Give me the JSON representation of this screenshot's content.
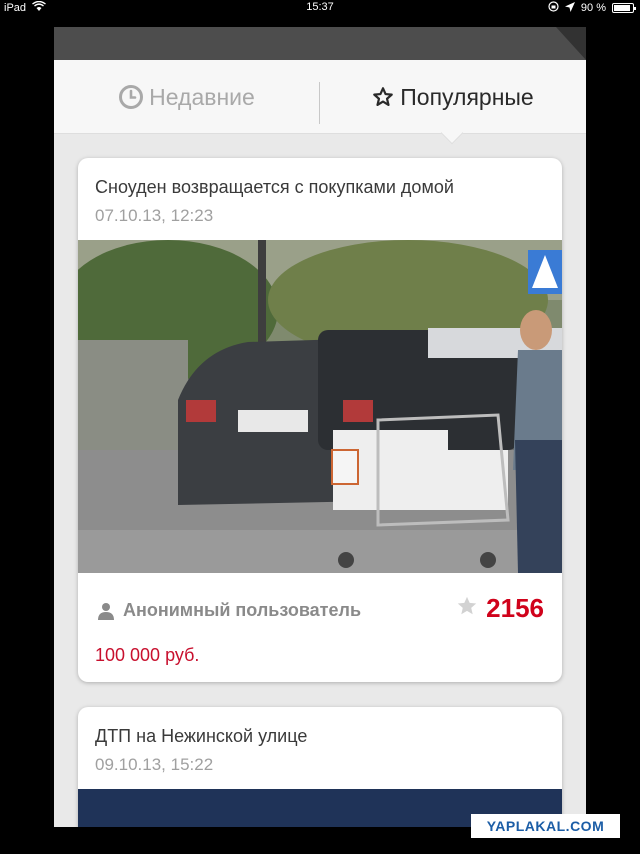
{
  "statusbar": {
    "device": "iPad",
    "time": "15:37",
    "battery_percent_label": "90 %",
    "battery_level": 0.9,
    "icons": [
      "wifi-icon",
      "rotation-lock-icon",
      "location-arrow-icon",
      "battery-icon"
    ]
  },
  "tabs": [
    {
      "label": "Недавние",
      "icon": "clock-icon",
      "active": false
    },
    {
      "label": "Популярные",
      "icon": "star-outline-icon",
      "active": true
    }
  ],
  "posts": [
    {
      "title": "Сноуден возвращается с покупками домой",
      "date": "07.10.13, 12:23",
      "author": "Анонимный пользователь",
      "author_icon": "user-icon",
      "rating_icon": "star-icon",
      "rating": "2156",
      "price": "100 000 руб."
    },
    {
      "title": "ДТП на Нежинской улице",
      "date": "09.10.13, 15:22"
    }
  ],
  "watermark": "YAPLAKAL.COM",
  "colors": {
    "accent_red": "#d0021b",
    "background": "#e9e9e9",
    "topbar": "#4d4d4d",
    "card": "#ffffff"
  }
}
